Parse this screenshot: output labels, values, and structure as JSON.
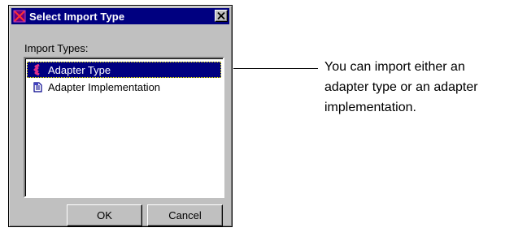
{
  "dialog": {
    "title": "Select Import Type",
    "section_label": "Import Types:",
    "items": [
      {
        "label": "Adapter Type",
        "selected": true,
        "icon": "adapter-type-icon"
      },
      {
        "label": "Adapter Implementation",
        "selected": false,
        "icon": "adapter-implementation-icon"
      }
    ],
    "ok_label": "OK",
    "cancel_label": "Cancel"
  },
  "callout": {
    "text": "You can import either an adapter type or an adapter implementation."
  },
  "colors": {
    "titlebar": "#000080",
    "selection": "#000080",
    "window_bg": "#c0c0c0"
  }
}
